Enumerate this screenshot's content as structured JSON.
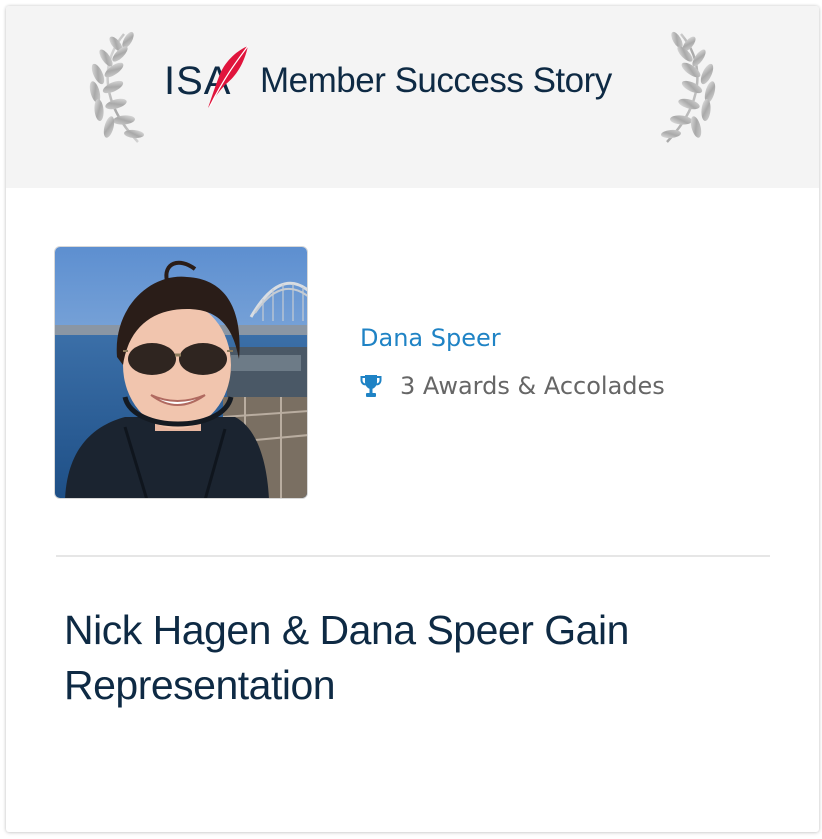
{
  "header": {
    "logo_text": "ISA",
    "title": "Member Success Story"
  },
  "colors": {
    "brand_navy": "#0e2a44",
    "quill_red": "#e0143c",
    "link_blue": "#1f83c5",
    "header_bg": "#f4f4f4",
    "laurel_silver": "#b9b9b9"
  },
  "member": {
    "name": "Dana Speer",
    "awards_icon": "trophy-icon",
    "awards_text": "3 Awards & Accolades"
  },
  "story": {
    "title": "Nick Hagen & Dana Speer Gain Representation"
  }
}
